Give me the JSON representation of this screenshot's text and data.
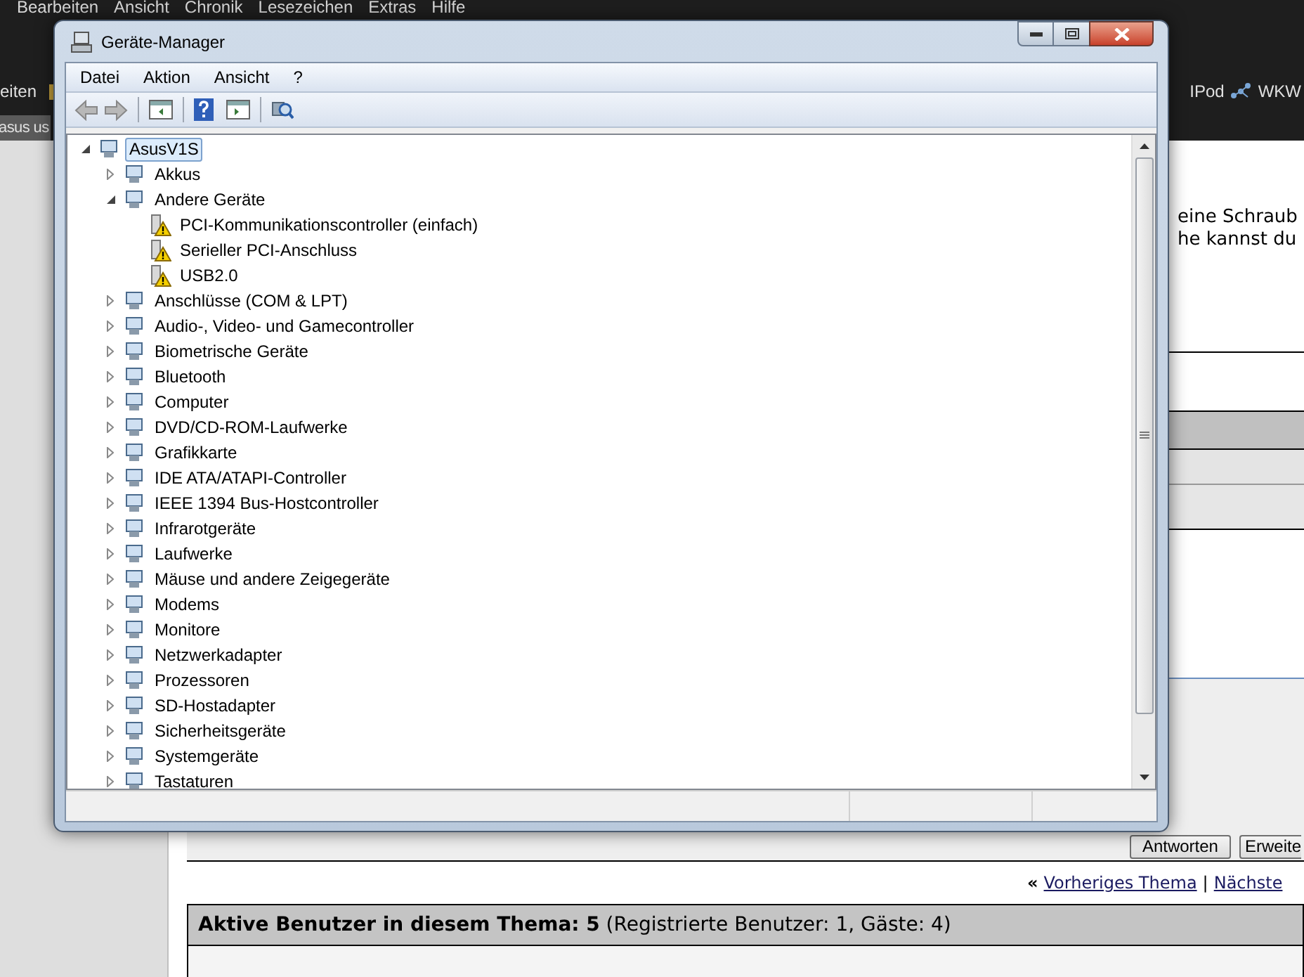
{
  "browser": {
    "menu": [
      "Bearbeiten",
      "Ansicht",
      "Chronik",
      "Lesezeichen",
      "Extras",
      "Hilfe"
    ],
    "bookmark_left": "eiten",
    "bookmarks_right": [
      "IPod",
      "WKW"
    ],
    "tab": "asus us"
  },
  "page": {
    "text_lines": [
      "eine Schraub",
      "he kannst du"
    ],
    "buttons": [
      "Antworten",
      "Erweite"
    ],
    "nav": {
      "prefix": "«",
      "previous": "Vorheriges Thema",
      "separator": "|",
      "next": "Nächste"
    },
    "active_users": "**Aktive Benutzer in diesem Thema: 5** (Registrierte Benutzer: 1, Gäste: 4)"
  },
  "window": {
    "title": "Geräte-Manager",
    "menu": [
      "Datei",
      "Aktion",
      "Ansicht",
      "?"
    ],
    "tree": [
      {
        "label": "AsusV1S",
        "expanded": true,
        "selected": true,
        "warning": false,
        "children": [
          {
            "label": "Akkus",
            "expanded": false,
            "selected": false,
            "warning": false
          },
          {
            "label": "Andere Geräte",
            "expanded": true,
            "selected": false,
            "warning": false,
            "children": [
              {
                "label": "PCI-Kommunikationscontroller (einfach)",
                "selected": false,
                "warning": true
              },
              {
                "label": "Serieller PCI-Anschluss",
                "selected": false,
                "warning": true
              },
              {
                "label": "USB2.0",
                "selected": false,
                "warning": true
              }
            ]
          },
          {
            "label": "Anschlüsse (COM & LPT)",
            "expanded": false,
            "selected": false,
            "warning": false
          },
          {
            "label": "Audio-, Video- und Gamecontroller",
            "expanded": false,
            "selected": false,
            "warning": false
          },
          {
            "label": "Biometrische Geräte",
            "expanded": false,
            "selected": false,
            "warning": false
          },
          {
            "label": "Bluetooth",
            "expanded": false,
            "selected": false,
            "warning": false
          },
          {
            "label": "Computer",
            "expanded": false,
            "selected": false,
            "warning": false
          },
          {
            "label": "DVD/CD-ROM-Laufwerke",
            "expanded": false,
            "selected": false,
            "warning": false
          },
          {
            "label": "Grafikkarte",
            "expanded": false,
            "selected": false,
            "warning": false
          },
          {
            "label": "IDE ATA/ATAPI-Controller",
            "expanded": false,
            "selected": false,
            "warning": false
          },
          {
            "label": "IEEE 1394 Bus-Hostcontroller",
            "expanded": false,
            "selected": false,
            "warning": false
          },
          {
            "label": "Infrarotgeräte",
            "expanded": false,
            "selected": false,
            "warning": false
          },
          {
            "label": "Laufwerke",
            "expanded": false,
            "selected": false,
            "warning": false
          },
          {
            "label": "Mäuse und andere Zeigegeräte",
            "expanded": false,
            "selected": false,
            "warning": false
          },
          {
            "label": "Modems",
            "expanded": false,
            "selected": false,
            "warning": false
          },
          {
            "label": "Monitore",
            "expanded": false,
            "selected": false,
            "warning": false
          },
          {
            "label": "Netzwerkadapter",
            "expanded": false,
            "selected": false,
            "warning": false
          },
          {
            "label": "Prozessoren",
            "expanded": false,
            "selected": false,
            "warning": false
          },
          {
            "label": "SD-Hostadapter",
            "expanded": false,
            "selected": false,
            "warning": false
          },
          {
            "label": "Sicherheitsgeräte",
            "expanded": false,
            "selected": false,
            "warning": false
          },
          {
            "label": "Systemgeräte",
            "expanded": false,
            "selected": false,
            "warning": false
          },
          {
            "label": "Tastaturen",
            "expanded": false,
            "selected": false,
            "warning": false
          }
        ]
      }
    ]
  }
}
